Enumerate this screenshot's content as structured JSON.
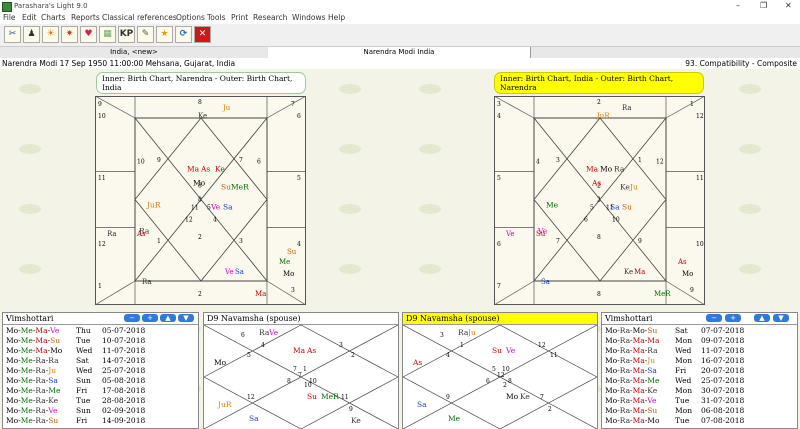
{
  "window": {
    "title": "Parashara's Light 9.0",
    "controls": [
      "–",
      "❐",
      "✕"
    ]
  },
  "menu": [
    "File",
    "Edit",
    "Charts",
    "Reports",
    "Classical references",
    "Options",
    "Tools",
    "Print",
    "Research",
    "Windows",
    "Help"
  ],
  "toolbar": {
    "buttons": [
      {
        "icon": "tools-icon",
        "glyph": "✂",
        "color": "#2a4fa8"
      },
      {
        "icon": "person-icon",
        "glyph": "♟",
        "color": "#333"
      },
      {
        "icon": "sun-icon",
        "glyph": "☀",
        "color": "#e07000"
      },
      {
        "icon": "burst-icon",
        "glyph": "✷",
        "color": "#c0392b"
      },
      {
        "icon": "heart-icon",
        "glyph": "♥",
        "color": "#d02060"
      },
      {
        "icon": "grid-icon",
        "glyph": "▦",
        "color": "#6a6"
      },
      {
        "icon": "kp-icon",
        "glyph": "KP",
        "color": "#333"
      },
      {
        "icon": "cell-icon",
        "glyph": "✎",
        "color": "#555"
      },
      {
        "icon": "star-icon",
        "glyph": "★",
        "color": "#e0a000"
      },
      {
        "icon": "refresh-icon",
        "glyph": "⟳",
        "color": "#1a6ad0"
      },
      {
        "icon": "close-icon",
        "glyph": "✕",
        "color": "#fff"
      }
    ]
  },
  "tabs": [
    {
      "label": "India,  <new>"
    },
    {
      "label": "Narendra Modi  India"
    }
  ],
  "status": {
    "left": "Narendra Modi 17 Sep 1950 11:00:00  Mehsana, Gujarat, India",
    "right": "93. Compatibility - Composite"
  },
  "charts": [
    {
      "title": "Inner: Birth Chart, Narendra - Outer: Birth Chart, India",
      "outer_numbers": [
        "9",
        "8",
        "7",
        "10",
        "6",
        "11",
        "5",
        "12",
        "4",
        "1",
        "2",
        "3"
      ],
      "inner_numbers": [
        "9",
        "8",
        "7",
        "10",
        "6",
        "11",
        "5",
        "12",
        "4",
        "1",
        "2",
        "3"
      ],
      "center": [
        "8"
      ],
      "outer_planets": [
        {
          "t": "Ju",
          "c": "#e08000"
        },
        {
          "t": "Ke",
          "c": "#333"
        },
        {
          "t": "Ra",
          "c": "#333"
        },
        {
          "t": "Ra",
          "c": "#333"
        },
        {
          "t": "As",
          "c": "#c00000"
        },
        {
          "t": "Ma",
          "c": "#c00000"
        },
        {
          "t": "Ve",
          "c": "#d000d0"
        },
        {
          "t": "Sa",
          "c": "#1040c0"
        },
        {
          "t": "Me",
          "c": "#007000"
        },
        {
          "t": "Mo",
          "c": "#000"
        },
        {
          "t": "Su",
          "c": "#c06000"
        }
      ],
      "inner_planets": [
        {
          "t": "Ma",
          "c": "#c00000"
        },
        {
          "t": "As",
          "c": "#c00000"
        },
        {
          "t": "Ke",
          "c": "#c00000"
        },
        {
          "t": "Mo",
          "c": "#000"
        },
        {
          "t": "Su",
          "c": "#c06000"
        },
        {
          "t": "MeR",
          "c": "#007000"
        },
        {
          "t": "JuR",
          "c": "#e08000"
        },
        {
          "t": "Ve",
          "c": "#d000d0"
        },
        {
          "t": "Sa",
          "c": "#1040c0"
        },
        {
          "t": "Ra",
          "c": "#333"
        }
      ]
    },
    {
      "title": "Inner: Birth Chart, India - Outer: Birth Chart, Narendra",
      "outer_numbers": [
        "3",
        "2",
        "1",
        "4",
        "12",
        "5",
        "11",
        "6",
        "10",
        "7",
        "8",
        "9"
      ],
      "inner_numbers": [
        "3",
        "2",
        "1",
        "4",
        "12",
        "5",
        "11",
        "6",
        "10",
        "7",
        "8",
        "9"
      ],
      "center": [
        "2"
      ],
      "outer_planets": [
        {
          "t": "Ra",
          "c": "#333"
        },
        {
          "t": "JuR",
          "c": "#e08000"
        },
        {
          "t": "Ve",
          "c": "#d000d0"
        },
        {
          "t": "Sa",
          "c": "#1040c0"
        },
        {
          "t": "Su",
          "c": "#c00000"
        },
        {
          "t": "MeR",
          "c": "#007000"
        },
        {
          "t": "Ke",
          "c": "#333"
        },
        {
          "t": "Ma",
          "c": "#c00000"
        },
        {
          "t": "As",
          "c": "#c00000"
        },
        {
          "t": "Mo",
          "c": "#000"
        }
      ],
      "inner_planets": [
        {
          "t": "Ma",
          "c": "#c00000"
        },
        {
          "t": "Mo",
          "c": "#000"
        },
        {
          "t": "Ra",
          "c": "#333"
        },
        {
          "t": "As",
          "c": "#c00000"
        },
        {
          "t": "Ke",
          "c": "#333"
        },
        {
          "t": "Ju",
          "c": "#e08000"
        },
        {
          "t": "Me",
          "c": "#007000"
        },
        {
          "t": "Sa",
          "c": "#1040c0"
        },
        {
          "t": "Su",
          "c": "#c06000"
        },
        {
          "t": "Ve",
          "c": "#d000d0"
        }
      ]
    }
  ],
  "vimshottari_left": {
    "title": "Vimshottari",
    "buttons": [
      "−",
      "+",
      "▲",
      "▼"
    ],
    "rows": [
      {
        "p": [
          {
            "t": "Mo",
            "c": "#000"
          },
          {
            "t": "Me",
            "c": "#007000"
          },
          {
            "t": "Ma",
            "c": "#c00000"
          },
          {
            "t": "Ve",
            "c": "#d000d0"
          }
        ],
        "day": "Thu",
        "date": "05-07-2018"
      },
      {
        "p": [
          {
            "t": "Mo",
            "c": "#000"
          },
          {
            "t": "Me",
            "c": "#007000"
          },
          {
            "t": "Ma",
            "c": "#c00000"
          },
          {
            "t": "Su",
            "c": "#c06000"
          }
        ],
        "day": "Tue",
        "date": "10-07-2018"
      },
      {
        "p": [
          {
            "t": "Mo",
            "c": "#000"
          },
          {
            "t": "Me",
            "c": "#007000"
          },
          {
            "t": "Ma",
            "c": "#c00000"
          },
          {
            "t": "Mo",
            "c": "#000"
          }
        ],
        "day": "Wed",
        "date": "11-07-2018"
      },
      {
        "p": [
          {
            "t": "Mo",
            "c": "#000"
          },
          {
            "t": "Me",
            "c": "#007000"
          },
          {
            "t": "Ra",
            "c": "#333"
          },
          {
            "t": "Ra",
            "c": "#333"
          }
        ],
        "day": "Sat",
        "date": "14-07-2018"
      },
      {
        "p": [
          {
            "t": "Mo",
            "c": "#000"
          },
          {
            "t": "Me",
            "c": "#007000"
          },
          {
            "t": "Ra",
            "c": "#333"
          },
          {
            "t": "Ju",
            "c": "#e08000"
          }
        ],
        "day": "Wed",
        "date": "25-07-2018"
      },
      {
        "p": [
          {
            "t": "Mo",
            "c": "#000"
          },
          {
            "t": "Me",
            "c": "#007000"
          },
          {
            "t": "Ra",
            "c": "#333"
          },
          {
            "t": "Sa",
            "c": "#1040c0"
          }
        ],
        "day": "Sun",
        "date": "05-08-2018"
      },
      {
        "p": [
          {
            "t": "Mo",
            "c": "#000"
          },
          {
            "t": "Me",
            "c": "#007000"
          },
          {
            "t": "Ra",
            "c": "#333"
          },
          {
            "t": "Me",
            "c": "#007000"
          }
        ],
        "day": "Fri",
        "date": "17-08-2018"
      },
      {
        "p": [
          {
            "t": "Mo",
            "c": "#000"
          },
          {
            "t": "Me",
            "c": "#007000"
          },
          {
            "t": "Ra",
            "c": "#333"
          },
          {
            "t": "Ke",
            "c": "#333"
          }
        ],
        "day": "Tue",
        "date": "28-08-2018"
      },
      {
        "p": [
          {
            "t": "Mo",
            "c": "#000"
          },
          {
            "t": "Me",
            "c": "#007000"
          },
          {
            "t": "Ra",
            "c": "#333"
          },
          {
            "t": "Ve",
            "c": "#d000d0"
          }
        ],
        "day": "Sun",
        "date": "02-09-2018"
      },
      {
        "p": [
          {
            "t": "Mo",
            "c": "#000"
          },
          {
            "t": "Me",
            "c": "#007000"
          },
          {
            "t": "Ra",
            "c": "#333"
          },
          {
            "t": "Su",
            "c": "#c06000"
          }
        ],
        "day": "Fri",
        "date": "14-09-2018"
      }
    ]
  },
  "navamsha_left": {
    "title": "D9 Navamsha  (spouse)",
    "numbers": [
      "6",
      "4",
      "3",
      "5",
      "2",
      "7",
      "1",
      "8",
      "10",
      "12",
      "11",
      "9"
    ],
    "center": [
      "7",
      "10"
    ],
    "planets": [
      {
        "t": "Ra",
        "c": "#333"
      },
      {
        "t": "Ve",
        "c": "#d000d0"
      },
      {
        "t": "Mo",
        "c": "#000"
      },
      {
        "t": "Ma",
        "c": "#c00000"
      },
      {
        "t": "As",
        "c": "#c00000"
      },
      {
        "t": "JuR",
        "c": "#e08000"
      },
      {
        "t": "Sa",
        "c": "#1040c0"
      },
      {
        "t": "Su",
        "c": "#c00000"
      },
      {
        "t": "MeR",
        "c": "#007000"
      },
      {
        "t": "Ke",
        "c": "#333"
      }
    ]
  },
  "navamsha_right": {
    "title": "D9 Navamsha  (spouse)",
    "numbers": [
      "3",
      "1",
      "12",
      "4",
      "11",
      "5",
      "10",
      "6",
      "8",
      "9",
      "7",
      "2"
    ],
    "center": [
      "12",
      "2"
    ],
    "planets": [
      {
        "t": "Ra",
        "c": "#333"
      },
      {
        "t": "Ju",
        "c": "#e08000"
      },
      {
        "t": "As",
        "c": "#c00000"
      },
      {
        "t": "Su",
        "c": "#c00000"
      },
      {
        "t": "Ve",
        "c": "#d000d0"
      },
      {
        "t": "Sa",
        "c": "#1040c0"
      },
      {
        "t": "Me",
        "c": "#007000"
      },
      {
        "t": "Mo",
        "c": "#000"
      },
      {
        "t": "Ke",
        "c": "#333"
      }
    ]
  },
  "vimshottari_right": {
    "title": "Vimshottari",
    "buttons": [
      "−",
      "+",
      "▲",
      "▼"
    ],
    "rows": [
      {
        "p": [
          {
            "t": "Mo",
            "c": "#000"
          },
          {
            "t": "Ra",
            "c": "#333"
          },
          {
            "t": "Mo",
            "c": "#000"
          },
          {
            "t": "Su",
            "c": "#c06000"
          }
        ],
        "day": "Sat",
        "date": "07-07-2018"
      },
      {
        "p": [
          {
            "t": "Mo",
            "c": "#000"
          },
          {
            "t": "Ra",
            "c": "#333"
          },
          {
            "t": "Ma",
            "c": "#c00000"
          },
          {
            "t": "Ma",
            "c": "#c00000"
          }
        ],
        "day": "Mon",
        "date": "09-07-2018"
      },
      {
        "p": [
          {
            "t": "Mo",
            "c": "#000"
          },
          {
            "t": "Ra",
            "c": "#333"
          },
          {
            "t": "Ma",
            "c": "#c00000"
          },
          {
            "t": "Ra",
            "c": "#333"
          }
        ],
        "day": "Wed",
        "date": "11-07-2018"
      },
      {
        "p": [
          {
            "t": "Mo",
            "c": "#000"
          },
          {
            "t": "Ra",
            "c": "#333"
          },
          {
            "t": "Ma",
            "c": "#c00000"
          },
          {
            "t": "Ju",
            "c": "#e08000"
          }
        ],
        "day": "Mon",
        "date": "16-07-2018"
      },
      {
        "p": [
          {
            "t": "Mo",
            "c": "#000"
          },
          {
            "t": "Ra",
            "c": "#333"
          },
          {
            "t": "Ma",
            "c": "#c00000"
          },
          {
            "t": "Sa",
            "c": "#1040c0"
          }
        ],
        "day": "Fri",
        "date": "20-07-2018"
      },
      {
        "p": [
          {
            "t": "Mo",
            "c": "#000"
          },
          {
            "t": "Ra",
            "c": "#333"
          },
          {
            "t": "Ma",
            "c": "#c00000"
          },
          {
            "t": "Me",
            "c": "#007000"
          }
        ],
        "day": "Wed",
        "date": "25-07-2018"
      },
      {
        "p": [
          {
            "t": "Mo",
            "c": "#000"
          },
          {
            "t": "Ra",
            "c": "#333"
          },
          {
            "t": "Ma",
            "c": "#c00000"
          },
          {
            "t": "Ke",
            "c": "#333"
          }
        ],
        "day": "Mon",
        "date": "30-07-2018"
      },
      {
        "p": [
          {
            "t": "Mo",
            "c": "#000"
          },
          {
            "t": "Ra",
            "c": "#333"
          },
          {
            "t": "Ma",
            "c": "#c00000"
          },
          {
            "t": "Ve",
            "c": "#d000d0"
          }
        ],
        "day": "Tue",
        "date": "31-07-2018"
      },
      {
        "p": [
          {
            "t": "Mo",
            "c": "#000"
          },
          {
            "t": "Ra",
            "c": "#333"
          },
          {
            "t": "Ma",
            "c": "#c00000"
          },
          {
            "t": "Su",
            "c": "#c06000"
          }
        ],
        "day": "Mon",
        "date": "06-08-2018"
      },
      {
        "p": [
          {
            "t": "Mo",
            "c": "#000"
          },
          {
            "t": "Ra",
            "c": "#333"
          },
          {
            "t": "Ma",
            "c": "#c00000"
          },
          {
            "t": "Mo",
            "c": "#000"
          }
        ],
        "day": "Tue",
        "date": "07-08-2018"
      }
    ]
  }
}
